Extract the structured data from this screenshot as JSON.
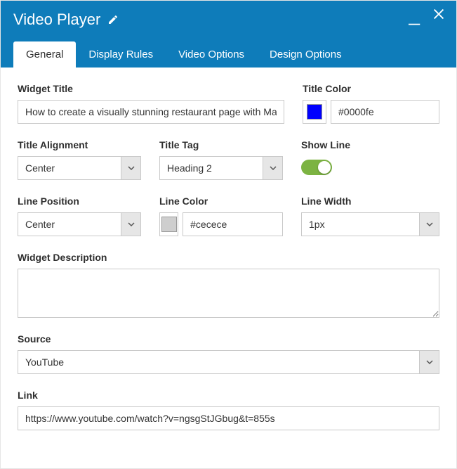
{
  "header": {
    "title": "Video Player"
  },
  "tabs": {
    "general": "General",
    "display_rules": "Display Rules",
    "video_options": "Video Options",
    "design_options": "Design Options",
    "active": "general"
  },
  "fields": {
    "widget_title": {
      "label": "Widget Title",
      "value": "How to create a visually stunning restaurant page with Mage"
    },
    "title_color": {
      "label": "Title Color",
      "value": "#0000fe",
      "swatch": "#0000fe"
    },
    "title_alignment": {
      "label": "Title Alignment",
      "value": "Center"
    },
    "title_tag": {
      "label": "Title Tag",
      "value": "Heading 2"
    },
    "show_line": {
      "label": "Show Line",
      "on": true
    },
    "line_position": {
      "label": "Line Position",
      "value": "Center"
    },
    "line_color": {
      "label": "Line Color",
      "value": "#cecece",
      "swatch": "#cecece"
    },
    "line_width": {
      "label": "Line Width",
      "value": "1px"
    },
    "widget_description": {
      "label": "Widget Description",
      "value": ""
    },
    "source": {
      "label": "Source",
      "value": "YouTube"
    },
    "link": {
      "label": "Link",
      "value": "https://www.youtube.com/watch?v=ngsgStJGbug&t=855s"
    }
  }
}
